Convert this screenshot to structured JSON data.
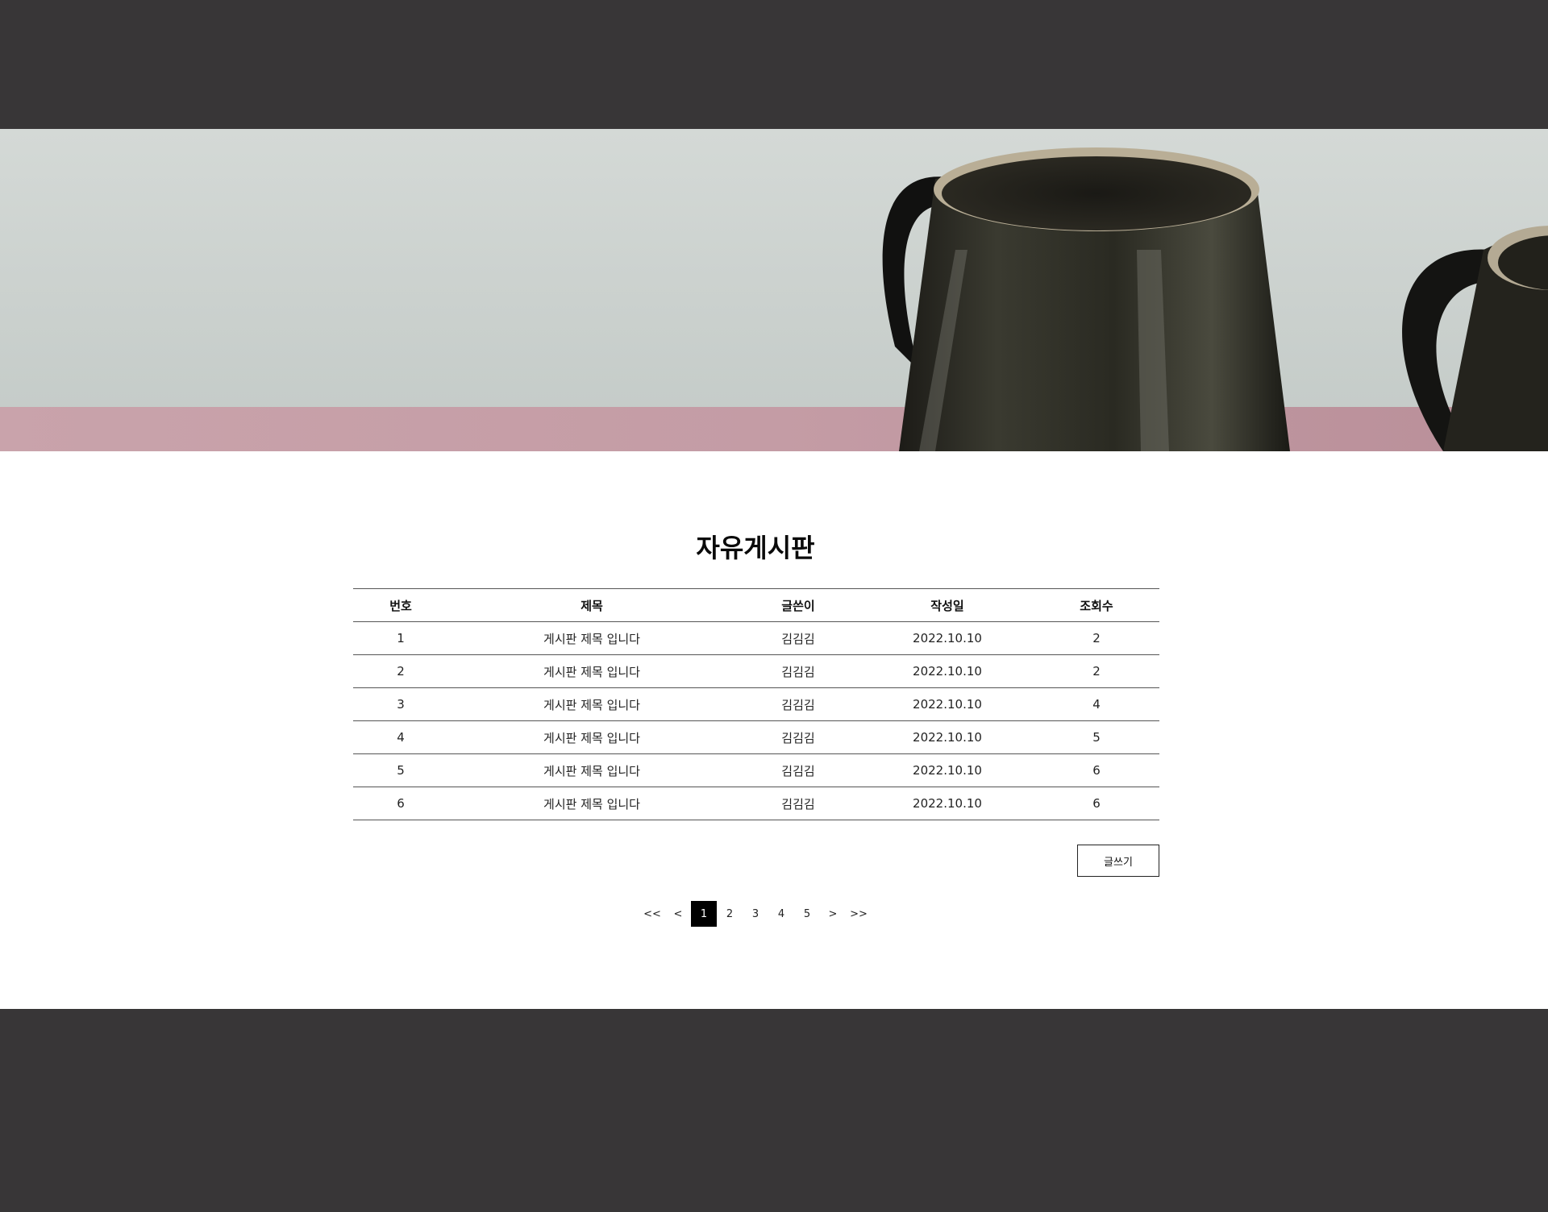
{
  "board": {
    "title": "자유게시판",
    "columns": {
      "no": "번호",
      "title": "제목",
      "author": "글쓴이",
      "date": "작성일",
      "views": "조회수"
    },
    "rows": [
      {
        "no": "1",
        "title": "게시판 제목 입니다",
        "author": "김김김",
        "date": "2022.10.10",
        "views": "2"
      },
      {
        "no": "2",
        "title": "게시판 제목 입니다",
        "author": "김김김",
        "date": "2022.10.10",
        "views": "2"
      },
      {
        "no": "3",
        "title": "게시판 제목 입니다",
        "author": "김김김",
        "date": "2022.10.10",
        "views": "4"
      },
      {
        "no": "4",
        "title": "게시판 제목 입니다",
        "author": "김김김",
        "date": "2022.10.10",
        "views": "5"
      },
      {
        "no": "5",
        "title": "게시판 제목 입니다",
        "author": "김김김",
        "date": "2022.10.10",
        "views": "6"
      },
      {
        "no": "6",
        "title": "게시판 제목 입니다",
        "author": "김김김",
        "date": "2022.10.10",
        "views": "6"
      }
    ],
    "write_label": "글쓰기"
  },
  "pagination": {
    "first": "<<",
    "prev": "<",
    "pages": [
      "1",
      "2",
      "3",
      "4",
      "5"
    ],
    "current": "1",
    "next": ">",
    "last": ">>"
  },
  "colors": {
    "header_bg": "#383637",
    "footer_bg": "#383637",
    "active_page_bg": "#000000"
  }
}
